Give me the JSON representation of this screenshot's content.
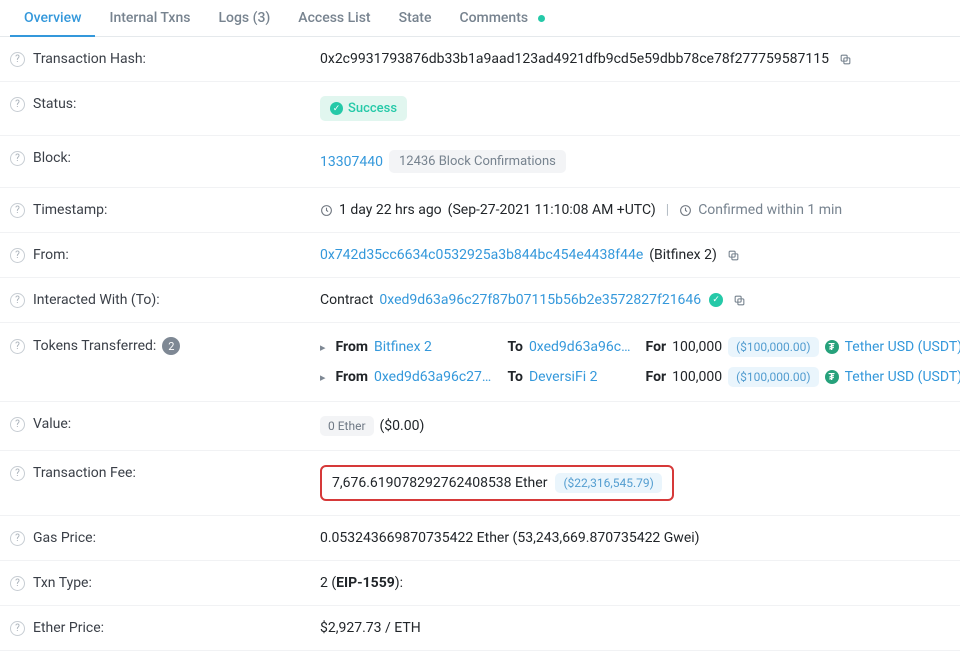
{
  "tabs": {
    "overview": "Overview",
    "internal": "Internal Txns",
    "logs": "Logs (3)",
    "access": "Access List",
    "state": "State",
    "comments": "Comments"
  },
  "labels": {
    "txhash": "Transaction Hash:",
    "status": "Status:",
    "block": "Block:",
    "timestamp": "Timestamp:",
    "from": "From:",
    "to": "Interacted With (To):",
    "tokens": "Tokens Transferred:",
    "value": "Value:",
    "txfee": "Transaction Fee:",
    "gasprice": "Gas Price:",
    "txtype": "Txn Type:",
    "etherprice": "Ether Price:",
    "tokens_count": "2"
  },
  "txhash": "0x2c9931793876db33b1a9aad123ad4921dfb9cd5e59dbb78ce78f277759587115",
  "status": "Success",
  "block": {
    "number": "13307440",
    "confirmations": "12436 Block Confirmations"
  },
  "timestamp": {
    "relative": "1 day 22 hrs ago",
    "absolute": "(Sep-27-2021 11:10:08 AM +UTC)",
    "confirmed": "Confirmed within 1 min"
  },
  "from": {
    "address": "0x742d35cc6634c0532925a3b844bc454e4438f44e",
    "label": "(Bitfinex 2)"
  },
  "to": {
    "prefix": "Contract",
    "address": "0xed9d63a96c27f87b07115b56b2e3572827f21646"
  },
  "transfers": [
    {
      "from_label": "From",
      "from": "Bitfinex 2",
      "to_label": "To",
      "to": "0xed9d63a96c27f…",
      "for_label": "For",
      "amount": "100,000",
      "usd": "($100,000.00)",
      "token": "Tether USD (USDT)"
    },
    {
      "from_label": "From",
      "from": "0xed9d63a96c27f…",
      "to_label": "To",
      "to": "DeversiFi 2",
      "for_label": "For",
      "amount": "100,000",
      "usd": "($100,000.00)",
      "token": "Tether USD (USDT)"
    }
  ],
  "value": {
    "eth": "0 Ether",
    "usd": "($0.00)"
  },
  "txfee": {
    "eth": "7,676.619078292762408538 Ether",
    "usd": "($22,316,545.79)"
  },
  "gasprice": "0.053243669870735422 Ether (53,243,669.870735422 Gwei)",
  "txtype": {
    "num": "2",
    "eip": "EIP-1559"
  },
  "etherprice": "$2,927.73 / ETH"
}
